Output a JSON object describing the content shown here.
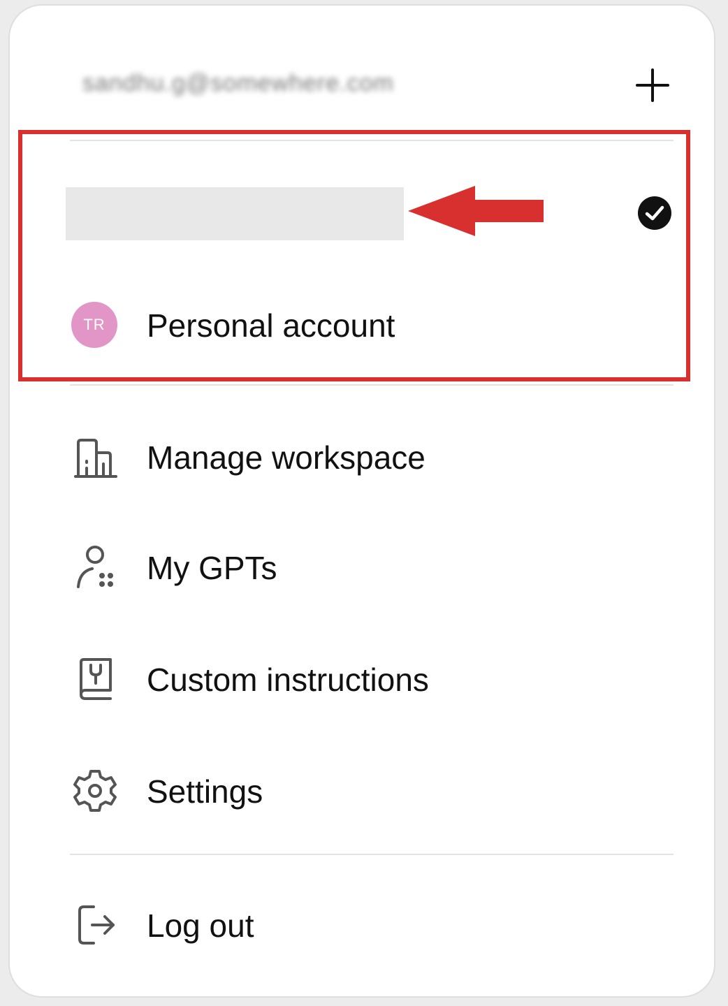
{
  "account": {
    "email": "sandhu.g@somewhere.com"
  },
  "workspace": {
    "name": "",
    "selected": true
  },
  "personal": {
    "avatar_initials": "TR",
    "label": "Personal account",
    "avatar_color": "#e296c7"
  },
  "menu": {
    "items": [
      {
        "label": "Manage workspace",
        "icon": "building-icon"
      },
      {
        "label": "My GPTs",
        "icon": "user-apps-icon"
      },
      {
        "label": "Custom instructions",
        "icon": "instructions-book-icon"
      },
      {
        "label": "Settings",
        "icon": "gear-icon"
      }
    ],
    "logout_label": "Log out"
  },
  "colors": {
    "annotation": "#d8302e",
    "text": "#111111",
    "icon": "#555555"
  }
}
